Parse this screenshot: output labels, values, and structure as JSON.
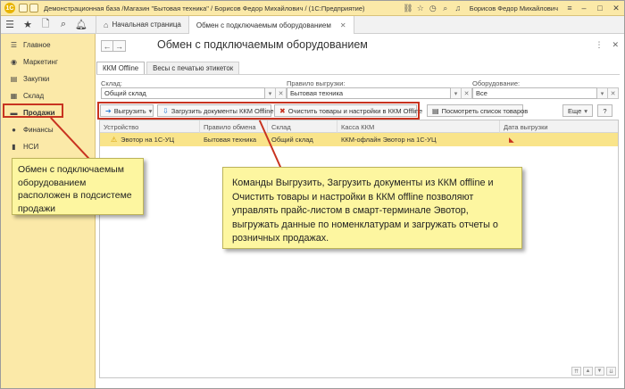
{
  "titlebar": {
    "title": "Демонстрационная база /Магазин \"Бытовая техника\" / Борисов Федор Михайлович / (1С:Предприятие)",
    "user": "Борисов Федор Михайлович"
  },
  "tabs": {
    "home": "Начальная страница",
    "active": "Обмен с подключаемым оборудованием"
  },
  "sidebar": {
    "items": [
      {
        "label": "Главное",
        "icon": "list-icon"
      },
      {
        "label": "Маркетинг",
        "icon": "marketing-icon"
      },
      {
        "label": "Закупки",
        "icon": "purchases-icon"
      },
      {
        "label": "Склад",
        "icon": "warehouse-icon"
      },
      {
        "label": "Продажи",
        "icon": "sales-icon"
      },
      {
        "label": "Финансы",
        "icon": "finance-icon"
      },
      {
        "label": "НСИ",
        "icon": "reference-icon"
      }
    ]
  },
  "page": {
    "title": "Обмен с подключаемым оборудованием",
    "subtabs": [
      "ККМ Offline",
      "Весы с печатью этикеток"
    ]
  },
  "filters": {
    "warehouse_label": "Склад:",
    "warehouse_value": "Общий склад",
    "rule_label": "Правило выгрузки:",
    "rule_value": "Бытовая техника",
    "equipment_label": "Оборудование:",
    "equipment_value": "Все"
  },
  "commands": {
    "upload": "Выгрузить",
    "load_docs": "Загрузить документы ККМ Offline",
    "clear": "Очистить товары и настройки в ККМ Offline",
    "view_list": "Посмотреть список товаров",
    "more": "Еще",
    "help": "?"
  },
  "grid": {
    "columns": [
      "Устройство",
      "Правило обмена",
      "Склад",
      "Касса ККМ",
      "Дата выгрузки"
    ],
    "rows": [
      {
        "device": "Эвотор на 1С-УЦ",
        "rule": "Бытовая техника",
        "warehouse": "Общий склад",
        "register": "ККМ-офлайн Эвотор на 1С-УЦ",
        "date": ""
      }
    ]
  },
  "callouts": {
    "left": "Обмен с подключаемым оборудованием расположен в подсистеме продажи",
    "right": "Команды Выгрузить, Загрузить документы из ККМ offline и Очистить товары и настройки в ККМ offline позволяют управлять прайс-листом в смарт-терминале Эвотор, выгружать данные по номенклатурам и загружать отчеты о розничных продажах."
  },
  "colors": {
    "sidebar_bg": "#fbe9a8",
    "selected_row": "#f9e48a",
    "highlight": "#c83320",
    "callout_bg": "#fdf6a0"
  }
}
